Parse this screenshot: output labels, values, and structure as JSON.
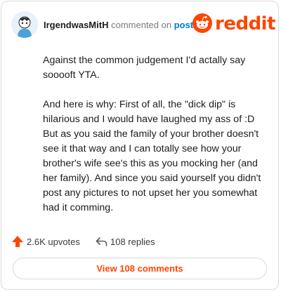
{
  "comment": {
    "username": "IrgendwasMitH",
    "action_text": "commented on",
    "post_link": "post",
    "paragraphs": [
      "Against the common judgement I'd actally say sooooft YTA.",
      "And here is why: First of all, the \"dick dip\" is hilarious and I would have laughed my ass of :D But as you said the family of your brother doesn't see it that way and I can totally see how your brother's wife see's this as you mocking her (and her family). And since you said yourself you didn't post any pictures to not upset her you somewhat had it comming."
    ]
  },
  "brand": {
    "name": "reddit",
    "color": "#ff4500"
  },
  "footer": {
    "upvotes": "2.6K upvotes",
    "replies": "108 replies",
    "view_button": "View 108 comments"
  },
  "colors": {
    "accent": "#ff4500",
    "link": "#0079d3",
    "muted": "#7c7c7c"
  }
}
